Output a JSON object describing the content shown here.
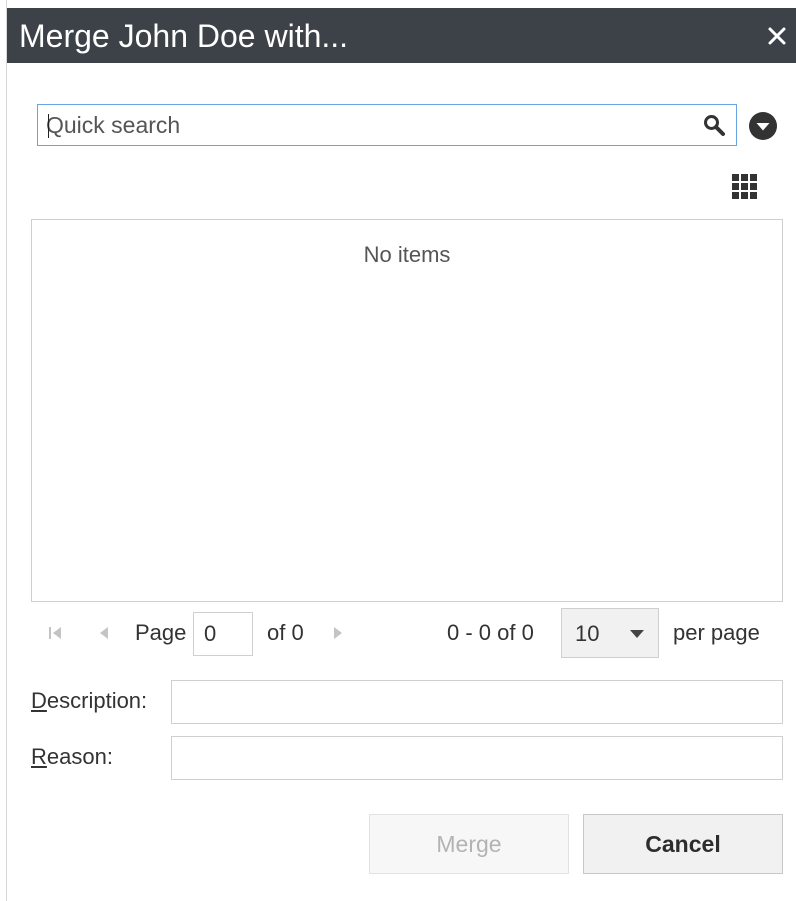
{
  "dialog": {
    "title": "Merge John  Doe with...",
    "close_icon": "close-icon"
  },
  "search": {
    "placeholder": "Quick search",
    "value": "",
    "icon": "search-icon",
    "options_icon": "chevron-down-circle-icon"
  },
  "view_toggle_icon": "grid-icon",
  "list": {
    "empty_text": "No items"
  },
  "pager": {
    "page_label": "Page",
    "page_value": "0",
    "of_label": "of 0",
    "range_text": "0 - 0 of 0",
    "per_page_value": "10",
    "per_page_label": "per page"
  },
  "form": {
    "description_label_first": "D",
    "description_label_rest": "escription:",
    "description_value": "",
    "reason_label_first": "R",
    "reason_label_rest": "eason:",
    "reason_value": ""
  },
  "buttons": {
    "merge_label": "Merge",
    "cancel_label": "Cancel"
  }
}
